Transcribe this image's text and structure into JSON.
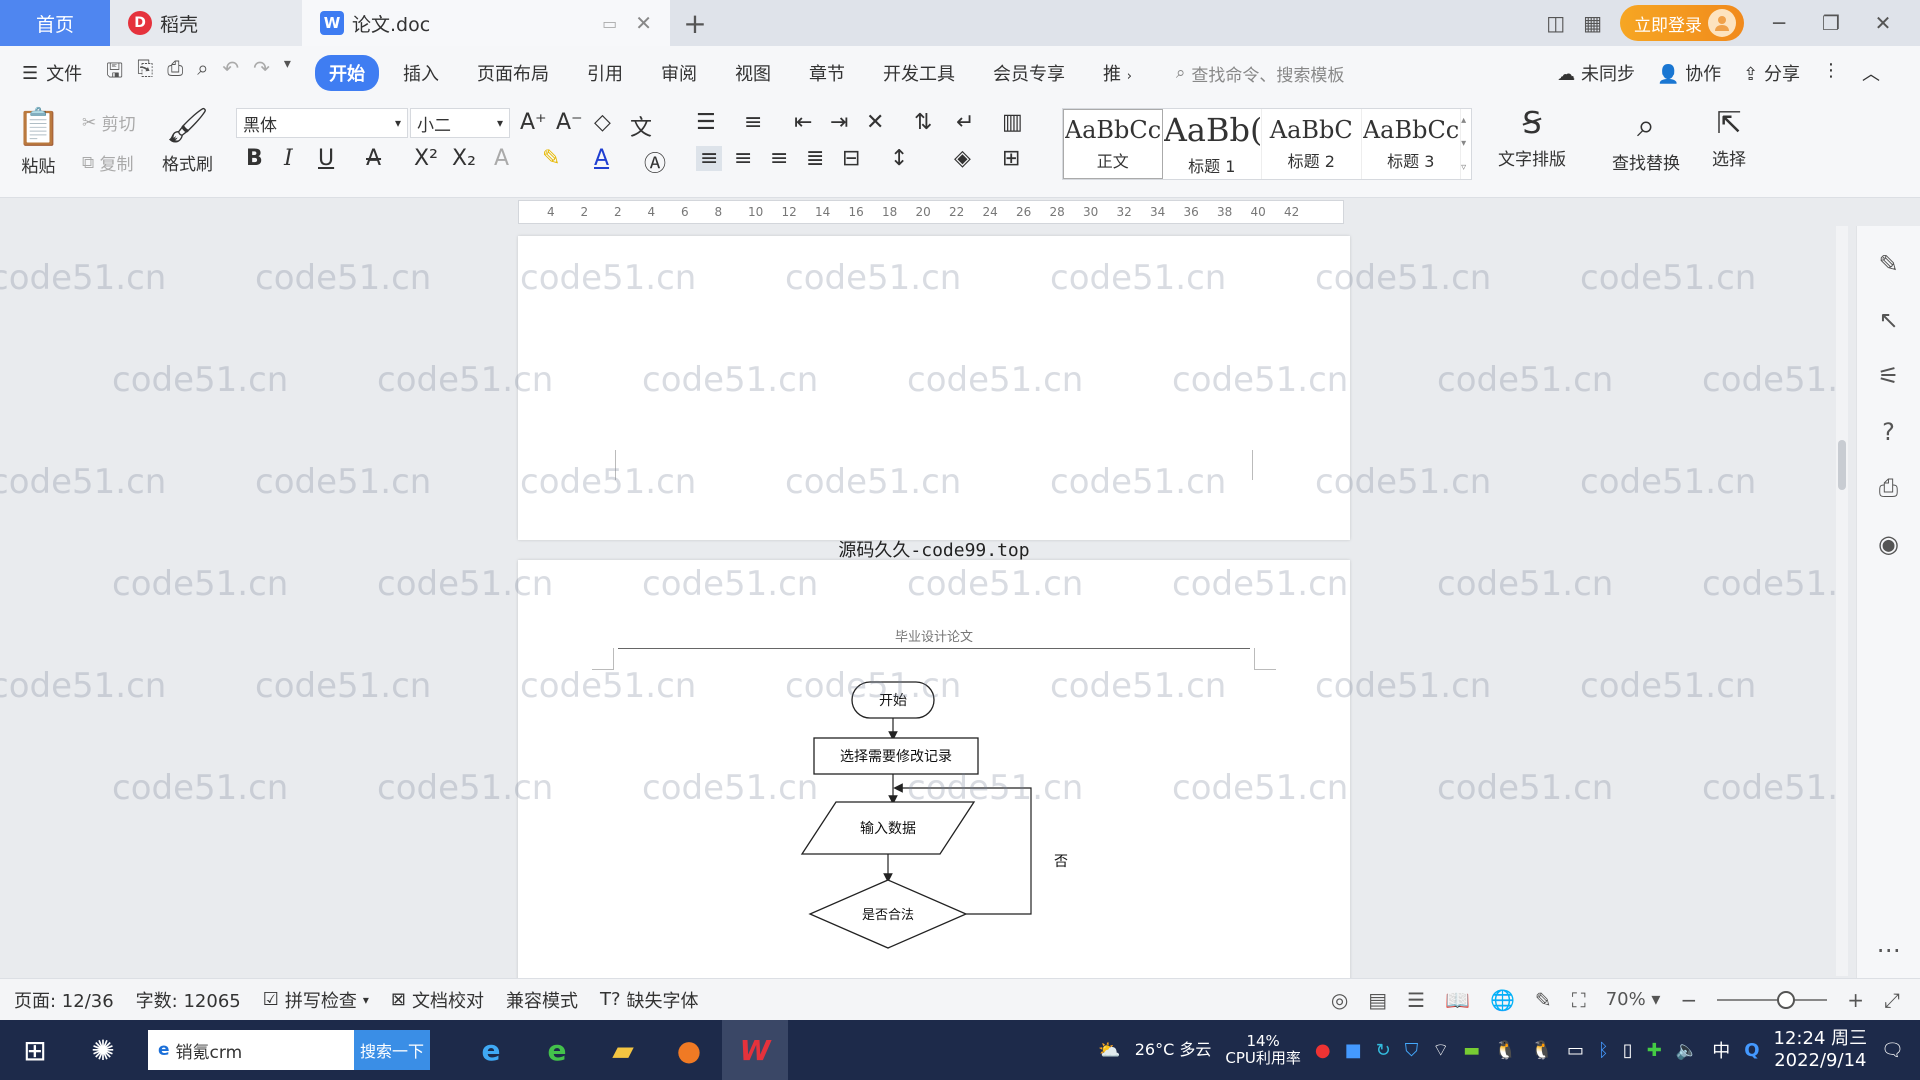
{
  "tabs": {
    "home": "首页",
    "daoke": "稻壳",
    "doc": "论文.doc",
    "login": "立即登录"
  },
  "menu": {
    "file": "文件",
    "items": [
      "开始",
      "插入",
      "页面布局",
      "引用",
      "审阅",
      "视图",
      "章节",
      "开发工具",
      "会员专享",
      "推"
    ],
    "search_cmd": "查找命令、搜索模板",
    "sync": "未同步",
    "collab": "协作",
    "share": "分享"
  },
  "ribbon": {
    "paste": "粘贴",
    "cut": "剪切",
    "copy": "复制",
    "format_painter": "格式刷",
    "font_name": "黑体",
    "font_size": "小二",
    "styles": [
      {
        "sample": "AaBbCcI",
        "name": "正文"
      },
      {
        "sample": "AaBb(",
        "name": "标题 1"
      },
      {
        "sample": "AaBbC",
        "name": "标题 2"
      },
      {
        "sample": "AaBbCc",
        "name": "标题 3"
      }
    ],
    "text_layout": "文字排版",
    "find_replace": "查找替换",
    "select": "选择"
  },
  "ruler_ticks": [
    "4",
    "2",
    "2",
    "4",
    "6",
    "8",
    "10",
    "12",
    "14",
    "16",
    "18",
    "20",
    "22",
    "24",
    "26",
    "28",
    "30",
    "32",
    "34",
    "36",
    "38",
    "40",
    "42"
  ],
  "document": {
    "page_separator_text": "源码久久-code99.top",
    "header_title": "毕业设计论文",
    "flowchart": {
      "start": "开始",
      "step1": "选择需要修改记录",
      "input": "输入数据",
      "decision": "是否合法",
      "no_label": "否"
    }
  },
  "watermark": "code51.cn",
  "status": {
    "page": "页面: 12/36",
    "word_count": "字数: 12065",
    "spell_check": "拼写检查",
    "doc_proof": "文档校对",
    "compat": "兼容模式",
    "missing_font": "缺失字体",
    "zoom": "70%"
  },
  "taskbar": {
    "search_value": "销氪crm",
    "search_btn": "搜索一下",
    "temp": "26°C",
    "weather": "多云",
    "cpu_pct": "14%",
    "cpu_label": "CPU利用率",
    "ime": "中",
    "time": "12:24 周三",
    "date": "2022/9/14"
  }
}
